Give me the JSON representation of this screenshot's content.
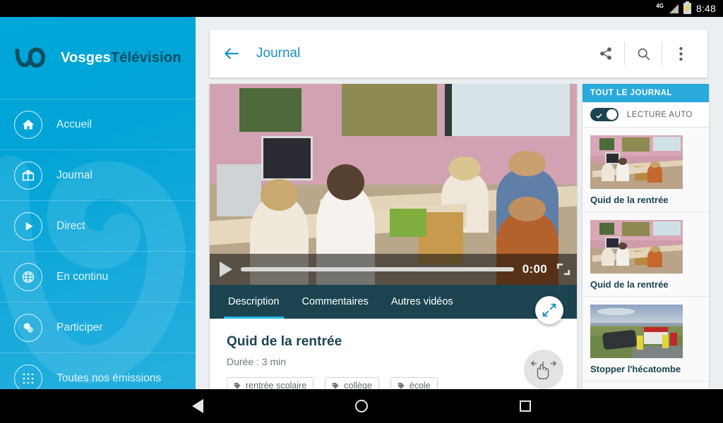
{
  "status_bar": {
    "network": "4G",
    "network_icon": "signal-4g-icon",
    "battery_icon": "battery-charging-icon",
    "time": "8:48"
  },
  "nav_bar": {
    "back_icon": "nav-back-icon",
    "home_icon": "nav-home-icon",
    "recents_icon": "nav-recents-icon"
  },
  "drawer": {
    "brand": {
      "name_bold": "Vosges",
      "name_rest": "Télévision",
      "logo_icon": "vosges-tv-logo-icon"
    },
    "items": [
      {
        "label": "Accueil",
        "icon": "home-icon"
      },
      {
        "label": "Journal",
        "icon": "newspaper-icon"
      },
      {
        "label": "Direct",
        "icon": "play-circle-icon"
      },
      {
        "label": "En continu",
        "icon": "globe-icon"
      },
      {
        "label": "Participer",
        "icon": "chat-bubbles-icon"
      },
      {
        "label": "Toutes nos émissions",
        "icon": "grid-dots-icon"
      }
    ]
  },
  "appbar": {
    "back_icon": "arrow-back-icon",
    "title": "Journal",
    "share_icon": "share-icon",
    "search_icon": "search-icon",
    "overflow_icon": "more-vertical-icon"
  },
  "player": {
    "play_icon": "play-icon",
    "time": "0:00",
    "progress_percent": 0,
    "fullscreen_icon": "fullscreen-icon",
    "resize_fab_icon": "resize-diagonal-icon",
    "swipe_hint_icon": "swipe-hand-icon"
  },
  "tabs": [
    {
      "label": "Description",
      "active": true
    },
    {
      "label": "Commentaires",
      "active": false
    },
    {
      "label": "Autres vidéos",
      "active": false
    }
  ],
  "description": {
    "title": "Quid de la rentrée",
    "duration": "Durée : 3 min",
    "tags": [
      {
        "label": "rentrée scolaire",
        "icon": "tag-icon"
      },
      {
        "label": "collège",
        "icon": "tag-icon"
      },
      {
        "label": "école",
        "icon": "tag-icon"
      }
    ]
  },
  "right_panel": {
    "header": "TOUT LE JOURNAL",
    "autoplay": {
      "label": "LECTURE AUTO",
      "enabled": true,
      "check_icon": "check-icon"
    },
    "items": [
      {
        "title": "Quid de la rentrée",
        "selected": true,
        "thumb": "classroom"
      },
      {
        "title": "Quid de la rentrée",
        "selected": false,
        "thumb": "classroom"
      },
      {
        "title": "Stopper l'hécatombe",
        "selected": false,
        "thumb": "crash"
      }
    ]
  },
  "colors": {
    "brand_cyan": "#00a7d8",
    "accent_blue": "#29a9dc",
    "tab_bar_dark": "#1b4450",
    "appbar_title": "#1891c6",
    "page_bg": "#eceff1"
  }
}
